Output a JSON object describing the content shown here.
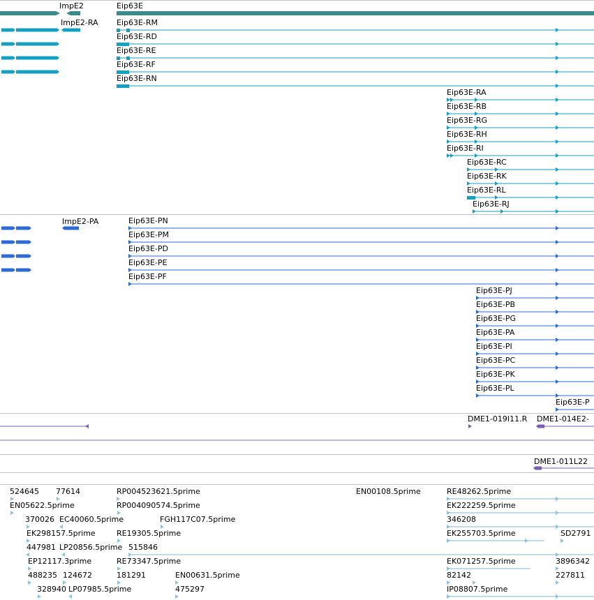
{
  "colors": {
    "gene": "#3a8a8a",
    "transcript": "#14a0c0",
    "protein": "#2c6bd6",
    "insertion": "#7a5bb5",
    "est_line": "#7cb8d6",
    "est_mark": "#8dc3e3",
    "separator": "#bcc4c8"
  },
  "genes": [
    {
      "name": "ImpE2"
    },
    {
      "name": "Eip63E"
    }
  ],
  "transcripts": [
    {
      "name": "ImpE2-RA"
    },
    {
      "name": "Eip63E-RM"
    },
    {
      "name": "Eip63E-RD"
    },
    {
      "name": "Eip63E-RE"
    },
    {
      "name": "Eip63E-RF"
    },
    {
      "name": "Eip63E-RN"
    },
    {
      "name": "Eip63E-RA"
    },
    {
      "name": "Eip63E-RB"
    },
    {
      "name": "Eip63E-RG"
    },
    {
      "name": "Eip63E-RH"
    },
    {
      "name": "Eip63E-RI"
    },
    {
      "name": "Eip63E-RC"
    },
    {
      "name": "Eip63E-RK"
    },
    {
      "name": "Eip63E-RL"
    },
    {
      "name": "Eip63E-RJ"
    }
  ],
  "proteins": [
    {
      "name": "ImpE2-PA"
    },
    {
      "name": "Eip63E-PN"
    },
    {
      "name": "Eip63E-PM"
    },
    {
      "name": "Eip63E-PD"
    },
    {
      "name": "Eip63E-PE"
    },
    {
      "name": "Eip63E-PF"
    },
    {
      "name": "Eip63E-PJ"
    },
    {
      "name": "Eip63E-PB"
    },
    {
      "name": "Eip63E-PG"
    },
    {
      "name": "Eip63E-PA"
    },
    {
      "name": "Eip63E-PI"
    },
    {
      "name": "Eip63E-PC"
    },
    {
      "name": "Eip63E-PK"
    },
    {
      "name": "Eip63E-PL"
    },
    {
      "name": "Eip63E-P"
    }
  ],
  "insertions": [
    {
      "name": "DME1-019I11.R"
    },
    {
      "name": "DME1-014E2-"
    },
    {
      "name": "DME1-011L22"
    }
  ],
  "ests": [
    {
      "name": "524645"
    },
    {
      "name": "77614"
    },
    {
      "name": "RP004523621.5prime"
    },
    {
      "name": "EN00108.5prime"
    },
    {
      "name": "RE48262.5prime"
    },
    {
      "name": "EN05622.5prime"
    },
    {
      "name": "RP004090574.5prime"
    },
    {
      "name": "EK222259.5prime"
    },
    {
      "name": "370026"
    },
    {
      "name": "EC40060.5prime"
    },
    {
      "name": "FGH117C07.5prime"
    },
    {
      "name": "346208"
    },
    {
      "name": "EK298157.5prime"
    },
    {
      "name": "RE19305.5prime"
    },
    {
      "name": "EK255703.5prime"
    },
    {
      "name": "SD2791"
    },
    {
      "name": "447981"
    },
    {
      "name": "LP20856.5prime"
    },
    {
      "name": "515846"
    },
    {
      "name": "EP12117.3prime"
    },
    {
      "name": "RE73347.5prime"
    },
    {
      "name": "EK071257.5prime"
    },
    {
      "name": "3896342"
    },
    {
      "name": "488235"
    },
    {
      "name": "124672"
    },
    {
      "name": "181291"
    },
    {
      "name": "EN00631.5prime"
    },
    {
      "name": "82142"
    },
    {
      "name": "227811"
    },
    {
      "name": "328940"
    },
    {
      "name": "LP07985.5prime"
    },
    {
      "name": "475297"
    },
    {
      "name": "IP08807.5prime"
    }
  ]
}
